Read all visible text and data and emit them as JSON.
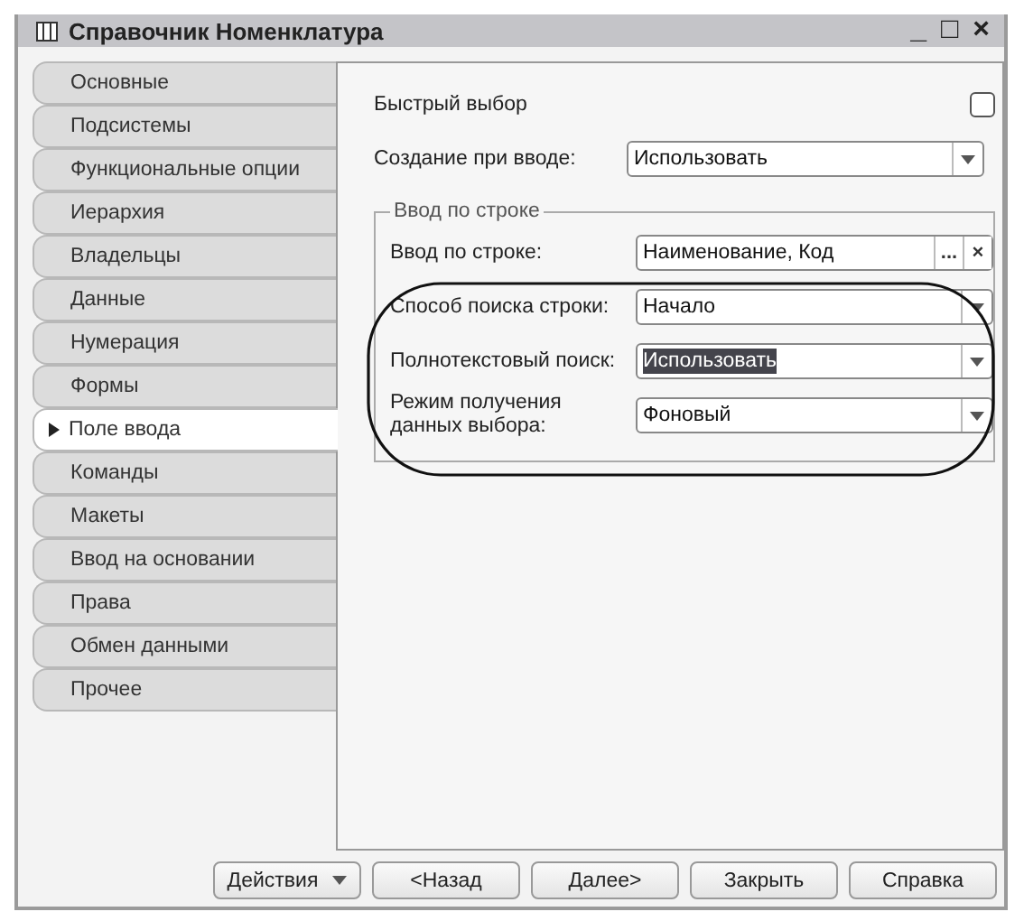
{
  "window": {
    "title": "Справочник Номенклатура",
    "controls": [
      "_",
      "□",
      "×"
    ]
  },
  "tabs": [
    {
      "label": "Основные",
      "selected": false
    },
    {
      "label": "Подсистемы",
      "selected": false
    },
    {
      "label": "Функциональные опции",
      "selected": false
    },
    {
      "label": "Иерархия",
      "selected": false
    },
    {
      "label": "Владельцы",
      "selected": false
    },
    {
      "label": "Данные",
      "selected": false
    },
    {
      "label": "Нумерация",
      "selected": false
    },
    {
      "label": "Формы",
      "selected": false
    },
    {
      "label": "Поле ввода",
      "selected": true
    },
    {
      "label": "Команды",
      "selected": false
    },
    {
      "label": "Макеты",
      "selected": false
    },
    {
      "label": "Ввод на основании",
      "selected": false
    },
    {
      "label": "Права",
      "selected": false
    },
    {
      "label": "Обмен данными",
      "selected": false
    },
    {
      "label": "Прочее",
      "selected": false
    }
  ],
  "fields": [
    {
      "kind": "checkbox",
      "label": "Быстрый выбор",
      "checked": false
    },
    {
      "kind": "dropdown",
      "label": "Создание при вводе:",
      "value": "Использовать",
      "highlighted": false
    }
  ],
  "group": {
    "title": "Ввод по строке",
    "fields": [
      {
        "kind": "list",
        "label": "Ввод по строке:",
        "value": "Наименование, Код",
        "buttons": [
          "...",
          "×"
        ]
      },
      {
        "kind": "dropdown",
        "label": "Способ поиска строки:",
        "value": "Начало",
        "highlighted": false
      },
      {
        "kind": "dropdown",
        "label": "Полнотекстовый поиск:",
        "value": "Использовать",
        "highlighted": true
      },
      {
        "kind": "dropdown",
        "label": "Режим получения данных выбора:",
        "value": "Фоновый",
        "highlighted": false
      }
    ]
  },
  "buttons": [
    {
      "label": "Действия",
      "kind": "menu"
    },
    {
      "label": "<Назад",
      "kind": "plain"
    },
    {
      "label": "Далее>",
      "kind": "plain"
    },
    {
      "label": "Закрыть",
      "kind": "plain"
    },
    {
      "label": "Справка",
      "kind": "plain"
    }
  ]
}
